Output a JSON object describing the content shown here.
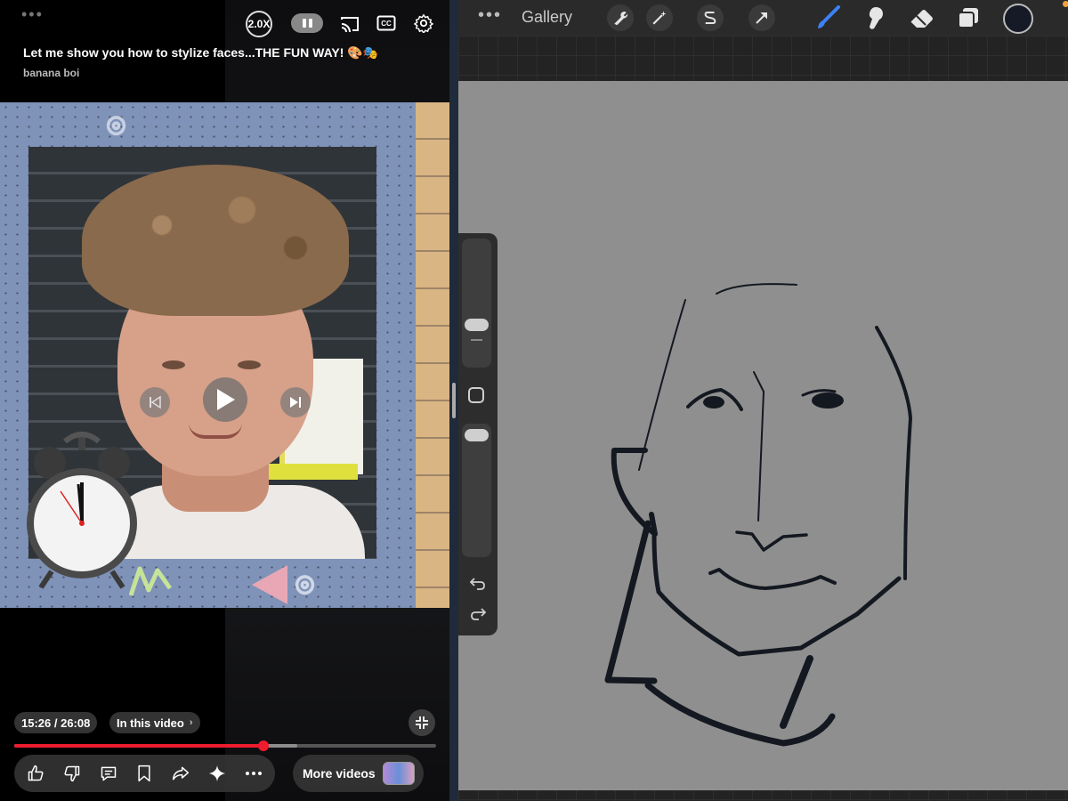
{
  "video_player": {
    "speed_label": "2.0X",
    "cc_label": "CC",
    "title": "Let me show you how to stylize faces...THE FUN WAY! 🎨🎭",
    "channel": "banana boi",
    "timestamp": "15:26 / 26:08",
    "chapters_label": "In this video",
    "progress": {
      "played_fraction": 0.59,
      "buffered_fraction": 0.67
    },
    "more_videos_label": "More videos",
    "actions": [
      "like-icon",
      "dislike-icon",
      "comment-icon",
      "save-icon",
      "share-icon",
      "remix-icon",
      "more-icon"
    ]
  },
  "drawing_app": {
    "gallery_label": "Gallery",
    "toolbar_icons": [
      "actions-wrench-icon",
      "adjustments-wand-icon",
      "selection-s-icon",
      "transform-arrow-icon"
    ],
    "tools": [
      "brush-icon",
      "smudge-icon",
      "eraser-icon",
      "layers-icon"
    ],
    "active_tool": "brush-icon",
    "current_color": "#161a26",
    "canvas_color": "#8f8f8f"
  },
  "colors": {
    "progress_red": "#ee1c2e",
    "brush_blue": "#3b82f6"
  }
}
